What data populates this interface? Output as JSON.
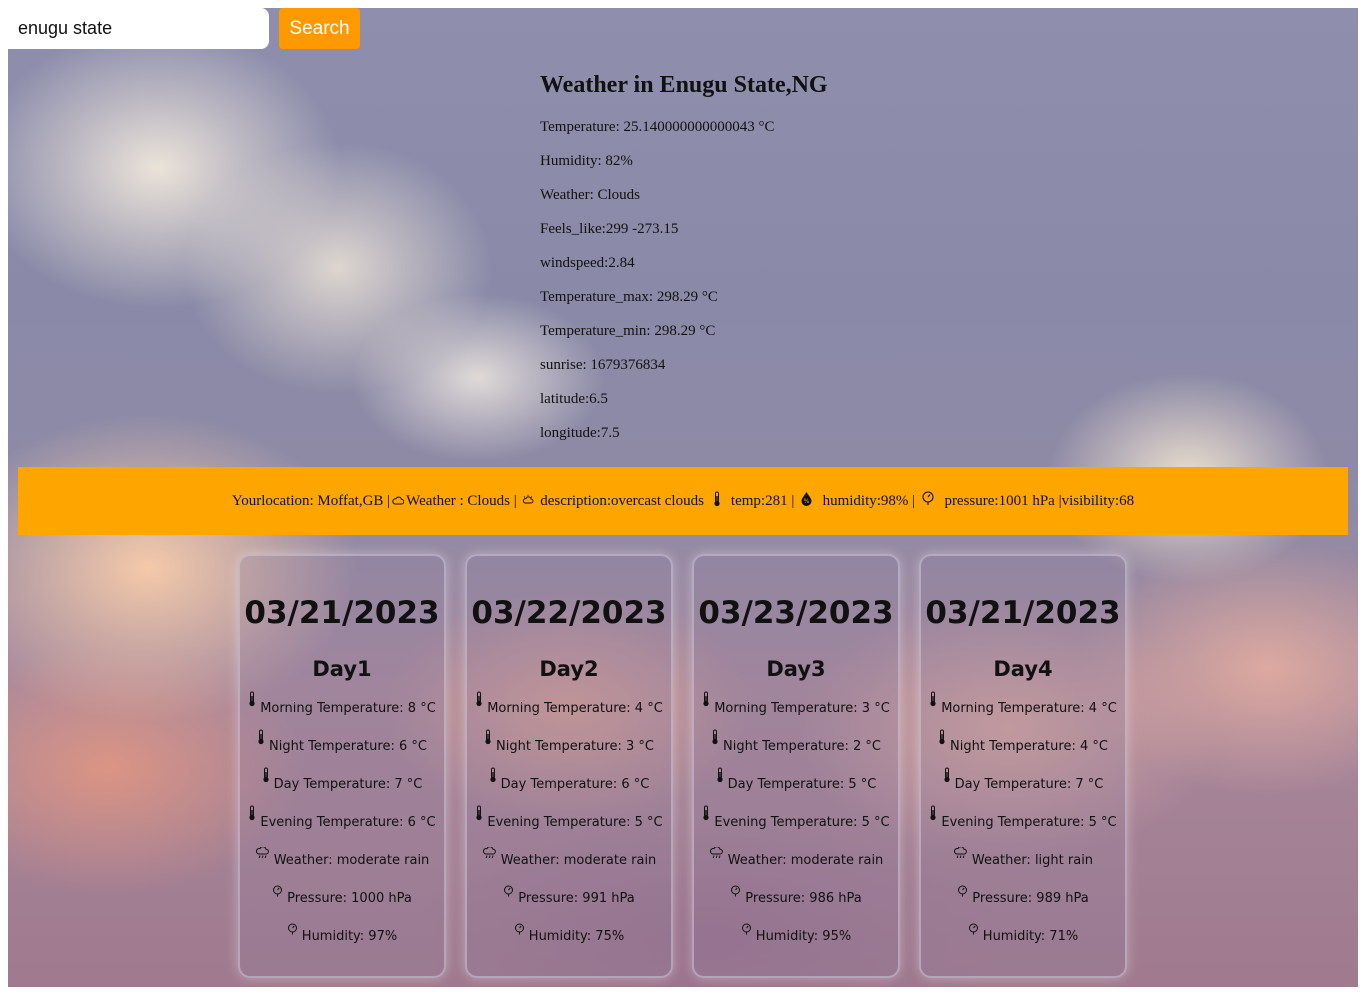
{
  "search": {
    "value": "enugu state",
    "button_label": "Search"
  },
  "current": {
    "title": "Weather in Enugu State,NG",
    "rows": [
      "Temperature: 25.140000000000043 °C",
      "Humidity: 82%",
      "Weather: Clouds",
      "Feels_like:299 -273.15",
      "windspeed:2.84",
      "Temperature_max: 298.29 °C",
      "Temperature_min: 298.29 °C",
      "sunrise: 1679376834",
      "latitude:6.5",
      "longitude:7.5"
    ]
  },
  "banner": {
    "location": "Yourlocation: Moffat,GB |",
    "weather": "Weather : Clouds |",
    "description": "description:overcast clouds",
    "temp": "temp:281 |",
    "humidity": "humidity:98% |",
    "pressure": "pressure:1001 hPa |visibility:68",
    "icons": [
      "cloud-icon",
      "cloud-sun-icon",
      "thermometer-icon",
      "humidity-icon",
      "pressure-icon"
    ]
  },
  "forecast": [
    {
      "date": "03/21/2023",
      "day": "Day1",
      "morning": "Morning Temperature: 8 °C",
      "night": "Night Temperature: 6 °C",
      "daytemp": "Day Temperature: 7 °C",
      "evening": "Evening Temperature: 6 °C",
      "weather": "Weather: moderate rain",
      "pressure": "Pressure: 1000 hPa",
      "humidity": "Humidity: 97%"
    },
    {
      "date": "03/22/2023",
      "day": "Day2",
      "morning": "Morning Temperature: 4 °C",
      "night": "Night Temperature: 3 °C",
      "daytemp": "Day Temperature: 6 °C",
      "evening": "Evening Temperature: 5 °C",
      "weather": "Weather: moderate rain",
      "pressure": "Pressure: 991 hPa",
      "humidity": "Humidity: 75%"
    },
    {
      "date": "03/23/2023",
      "day": "Day3",
      "morning": "Morning Temperature: 3 °C",
      "night": "Night Temperature: 2 °C",
      "daytemp": "Day Temperature: 5 °C",
      "evening": "Evening Temperature: 5 °C",
      "weather": "Weather: moderate rain",
      "pressure": "Pressure: 986 hPa",
      "humidity": "Humidity: 95%"
    },
    {
      "date": "03/21/2023",
      "day": "Day4",
      "morning": "Morning Temperature: 4 °C",
      "night": "Night Temperature: 4 °C",
      "daytemp": "Day Temperature: 7 °C",
      "evening": "Evening Temperature: 5 °C",
      "weather": "Weather: light rain",
      "pressure": "Pressure: 989 hPa",
      "humidity": "Humidity: 71%"
    }
  ],
  "colors": {
    "accent": "#ffa500",
    "button": "#ff9900"
  }
}
